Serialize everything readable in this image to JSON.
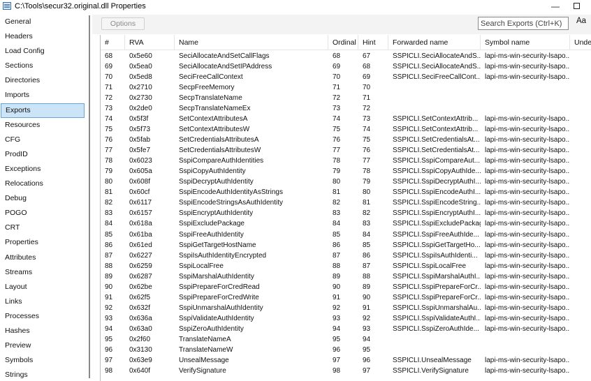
{
  "window": {
    "title": "C:\\Tools\\secur32.original.dll Properties",
    "minimize_glyph": "—"
  },
  "sidebar": {
    "selected": "Exports",
    "items": [
      "General",
      "Headers",
      "Load Config",
      "Sections",
      "Directories",
      "Imports",
      "Exports",
      "Resources",
      "CFG",
      "ProdID",
      "Exceptions",
      "Relocations",
      "Debug",
      "POGO",
      "CRT",
      "Properties",
      "Attributes",
      "Streams",
      "Layout",
      "Links",
      "Processes",
      "Hashes",
      "Preview",
      "Symbols",
      "Strings"
    ]
  },
  "toolbar": {
    "options_label": "Options",
    "search_placeholder": "Search Exports (Ctrl+K)",
    "search_value": "",
    "aa_label": "Aa"
  },
  "table": {
    "sort_indicator": "^",
    "columns": [
      "#",
      "RVA",
      "Name",
      "Ordinal",
      "Hint",
      "Forwarded name",
      "Symbol name",
      "Unde"
    ],
    "rows": [
      [
        "68",
        "0x5e60",
        "SeciAllocateAndSetCallFlags",
        "68",
        "67",
        "SSPICLI.SeciAllocateAndS...",
        "lapi-ms-win-security-lsapo..."
      ],
      [
        "69",
        "0x5ea0",
        "SeciAllocateAndSetIPAddress",
        "69",
        "68",
        "SSPICLI.SeciAllocateAndS...",
        "lapi-ms-win-security-lsapo..."
      ],
      [
        "70",
        "0x5ed8",
        "SeciFreeCallContext",
        "70",
        "69",
        "SSPICLI.SeciFreeCallCont...",
        "lapi-ms-win-security-lsapo..."
      ],
      [
        "71",
        "0x2710",
        "SecpFreeMemory",
        "71",
        "70",
        "",
        ""
      ],
      [
        "72",
        "0x2730",
        "SecpTranslateName",
        "72",
        "71",
        "",
        ""
      ],
      [
        "73",
        "0x2de0",
        "SecpTranslateNameEx",
        "73",
        "72",
        "",
        ""
      ],
      [
        "74",
        "0x5f3f",
        "SetContextAttributesA",
        "74",
        "73",
        "SSPICLI.SetContextAttrib...",
        "lapi-ms-win-security-lsapo..."
      ],
      [
        "75",
        "0x5f73",
        "SetContextAttributesW",
        "75",
        "74",
        "SSPICLI.SetContextAttrib...",
        "lapi-ms-win-security-lsapo..."
      ],
      [
        "76",
        "0x5fab",
        "SetCredentialsAttributesA",
        "76",
        "75",
        "SSPICLI.SetCredentialsAt...",
        "lapi-ms-win-security-lsapo..."
      ],
      [
        "77",
        "0x5fe7",
        "SetCredentialsAttributesW",
        "77",
        "76",
        "SSPICLI.SetCredentialsAt...",
        "lapi-ms-win-security-lsapo..."
      ],
      [
        "78",
        "0x6023",
        "SspiCompareAuthIdentities",
        "78",
        "77",
        "SSPICLI.SspiCompareAut...",
        "lapi-ms-win-security-lsapo..."
      ],
      [
        "79",
        "0x605a",
        "SspiCopyAuthIdentity",
        "79",
        "78",
        "SSPICLI.SspiCopyAuthIde...",
        "lapi-ms-win-security-lsapo..."
      ],
      [
        "80",
        "0x608f",
        "SspiDecryptAuthIdentity",
        "80",
        "79",
        "SSPICLI.SspiDecryptAuthI...",
        "lapi-ms-win-security-lsapo..."
      ],
      [
        "81",
        "0x60cf",
        "SspiEncodeAuthIdentityAsStrings",
        "81",
        "80",
        "SSPICLI.SspiEncodeAuthI...",
        "lapi-ms-win-security-lsapo..."
      ],
      [
        "82",
        "0x6117",
        "SspiEncodeStringsAsAuthIdentity",
        "82",
        "81",
        "SSPICLI.SspiEncodeString...",
        "lapi-ms-win-security-lsapo..."
      ],
      [
        "83",
        "0x6157",
        "SspiEncryptAuthIdentity",
        "83",
        "82",
        "SSPICLI.SspiEncryptAuthI...",
        "lapi-ms-win-security-lsapo..."
      ],
      [
        "84",
        "0x618a",
        "SspiExcludePackage",
        "84",
        "83",
        "SSPICLI.SspiExcludePackage",
        "lapi-ms-win-security-lsapo..."
      ],
      [
        "85",
        "0x61ba",
        "SspiFreeAuthIdentity",
        "85",
        "84",
        "SSPICLI.SspiFreeAuthIde...",
        "lapi-ms-win-security-lsapo..."
      ],
      [
        "86",
        "0x61ed",
        "SspiGetTargetHostName",
        "86",
        "85",
        "SSPICLI.SspiGetTargetHo...",
        "lapi-ms-win-security-lsapo..."
      ],
      [
        "87",
        "0x6227",
        "SspiIsAuthIdentityEncrypted",
        "87",
        "86",
        "SSPICLI.SspiIsAuthIdenti...",
        "lapi-ms-win-security-lsapo..."
      ],
      [
        "88",
        "0x6259",
        "SspiLocalFree",
        "88",
        "87",
        "SSPICLI.SspiLocalFree",
        "lapi-ms-win-security-lsapo..."
      ],
      [
        "89",
        "0x6287",
        "SspiMarshalAuthIdentity",
        "89",
        "88",
        "SSPICLI.SspiMarshalAuthI...",
        "lapi-ms-win-security-lsapo..."
      ],
      [
        "90",
        "0x62be",
        "SspiPrepareForCredRead",
        "90",
        "89",
        "SSPICLI.SspiPrepareForCr...",
        "lapi-ms-win-security-lsapo..."
      ],
      [
        "91",
        "0x62f5",
        "SspiPrepareForCredWrite",
        "91",
        "90",
        "SSPICLI.SspiPrepareForCr...",
        "lapi-ms-win-security-lsapo..."
      ],
      [
        "92",
        "0x632f",
        "SspiUnmarshalAuthIdentity",
        "92",
        "91",
        "SSPICLI.SspiUnmarshalAu...",
        "lapi-ms-win-security-lsapo..."
      ],
      [
        "93",
        "0x636a",
        "SspiValidateAuthIdentity",
        "93",
        "92",
        "SSPICLI.SspiValidateAuthI...",
        "lapi-ms-win-security-lsapo..."
      ],
      [
        "94",
        "0x63a0",
        "SspiZeroAuthIdentity",
        "94",
        "93",
        "SSPICLI.SspiZeroAuthIde...",
        "lapi-ms-win-security-lsapo..."
      ],
      [
        "95",
        "0x2f60",
        "TranslateNameA",
        "95",
        "94",
        "",
        ""
      ],
      [
        "96",
        "0x3130",
        "TranslateNameW",
        "96",
        "95",
        "",
        ""
      ],
      [
        "97",
        "0x63e9",
        "UnsealMessage",
        "97",
        "96",
        "SSPICLI.UnsealMessage",
        "lapi-ms-win-security-lsapo..."
      ],
      [
        "98",
        "0x640f",
        "VerifySignature",
        "98",
        "97",
        "SSPICLI.VerifySignature",
        "lapi-ms-win-security-lsapo..."
      ]
    ]
  }
}
